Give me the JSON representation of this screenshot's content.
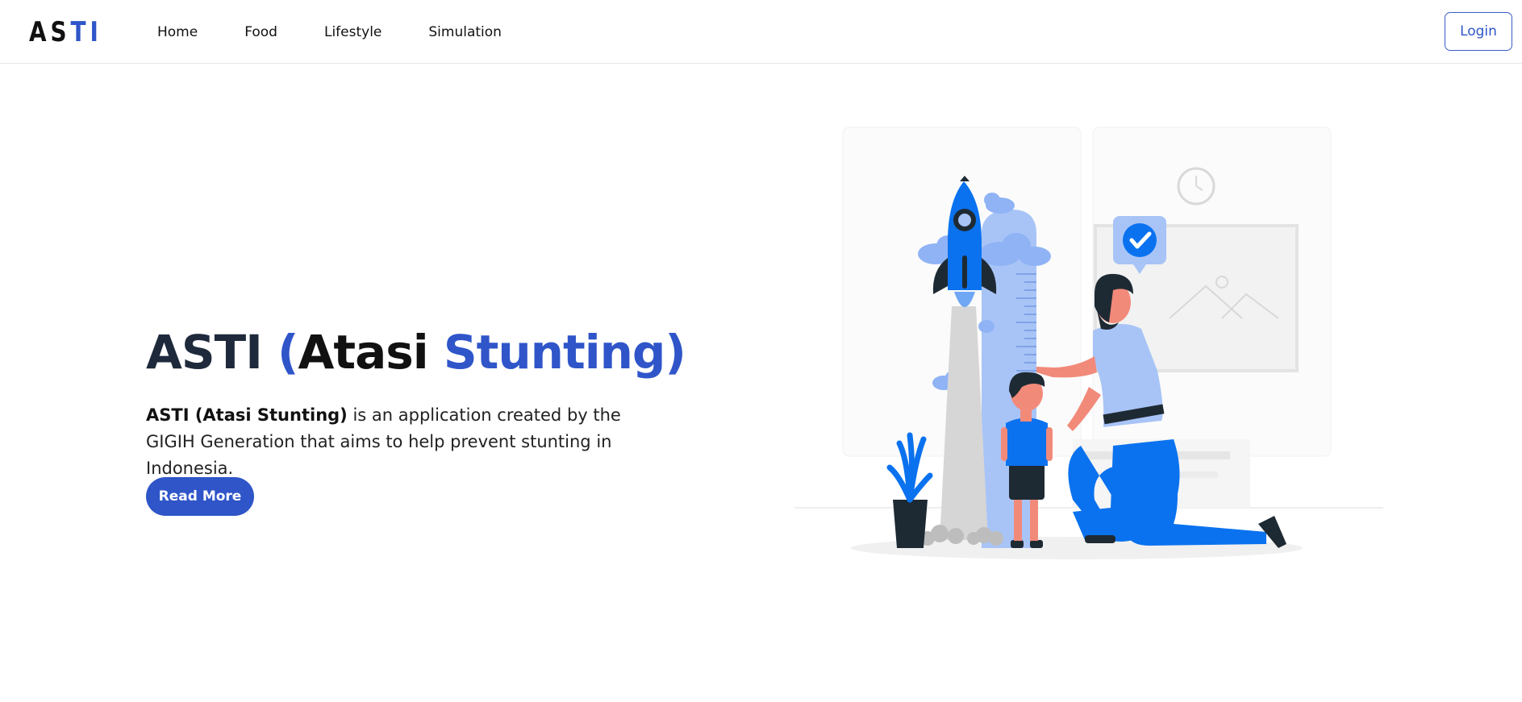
{
  "nav": {
    "logo": {
      "part1": "AS",
      "part2": "TI"
    },
    "links": [
      "Home",
      "Food",
      "Lifestyle",
      "Simulation"
    ],
    "login_label": "Login"
  },
  "hero": {
    "title": {
      "brand": "ASTI",
      "open_paren": "(",
      "word1": "Atasi",
      "word2": "Stunting)"
    },
    "description_bold": "ASTI (Atasi Stunting)",
    "description_rest": " is an application created by the GIGIH Generation that aims to help prevent stunting in Indonesia.",
    "cta_label": "Read More"
  },
  "colors": {
    "accent": "#2f55c9",
    "highlight": "#3f8fe0",
    "illustration_blue": "#0a72ef",
    "illustration_light": "#a8c4f7"
  }
}
